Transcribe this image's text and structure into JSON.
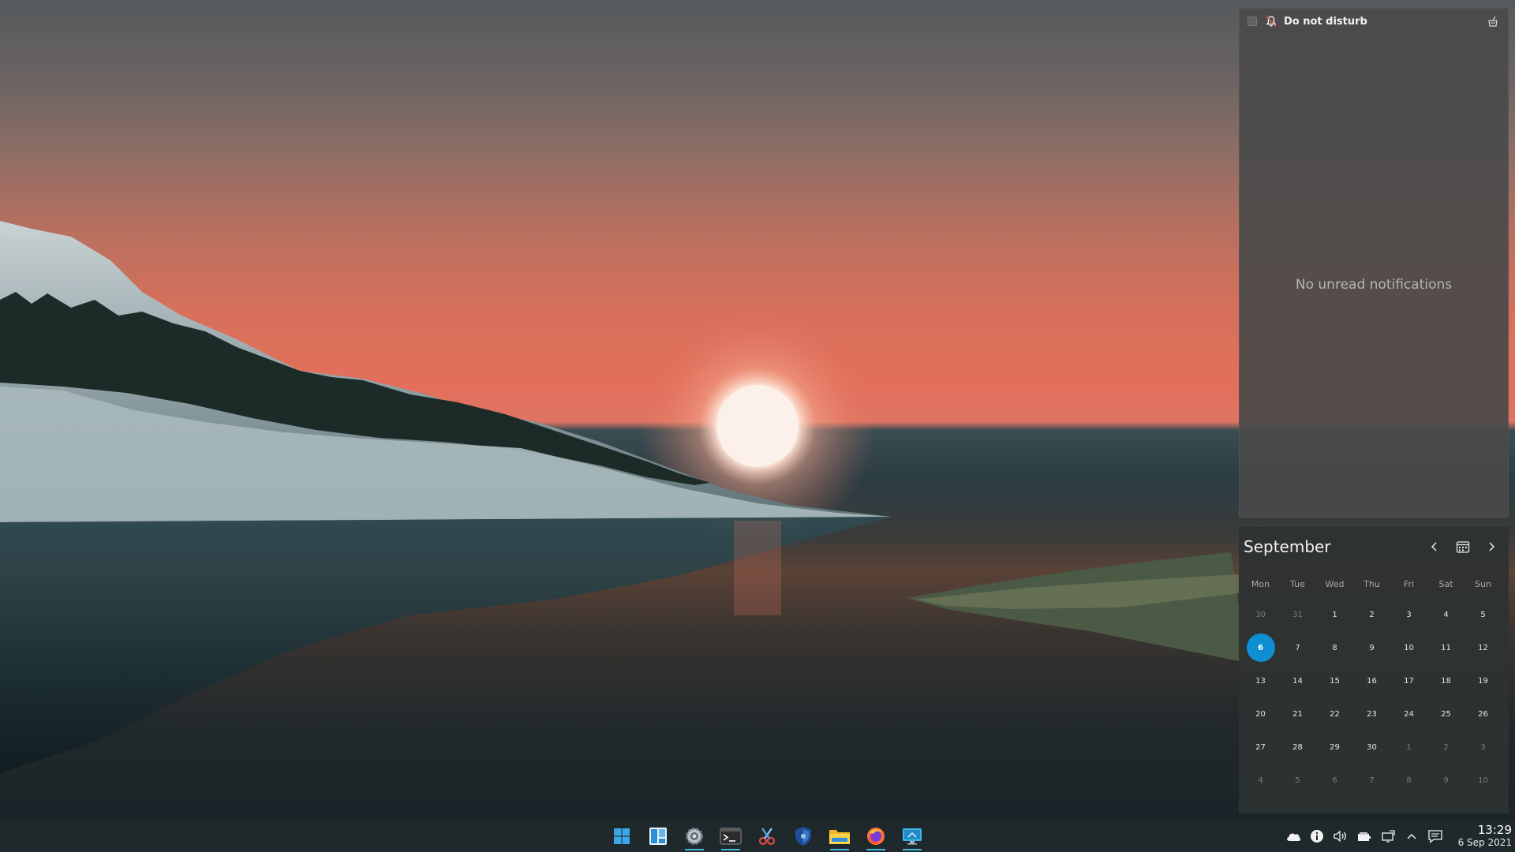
{
  "notifications": {
    "dnd_label": "Do not disturb",
    "empty_message": "No unread notifications"
  },
  "calendar": {
    "month": "September",
    "weekdays": [
      "Mon",
      "Tue",
      "Wed",
      "Thu",
      "Fri",
      "Sat",
      "Sun"
    ],
    "weeks": [
      [
        "30",
        "31",
        "1",
        "2",
        "3",
        "4",
        "5"
      ],
      [
        "6",
        "7",
        "8",
        "9",
        "10",
        "11",
        "12"
      ],
      [
        "13",
        "14",
        "15",
        "16",
        "17",
        "18",
        "19"
      ],
      [
        "20",
        "21",
        "22",
        "23",
        "24",
        "25",
        "26"
      ],
      [
        "27",
        "28",
        "29",
        "30",
        "1",
        "2",
        "3"
      ],
      [
        "4",
        "5",
        "6",
        "7",
        "8",
        "9",
        "10"
      ]
    ],
    "today": "6",
    "accent_color": "#0e8fd4"
  },
  "taskbar": {
    "apps": [
      {
        "name": "start-menu",
        "icon": "windows-logo-icon",
        "active": false
      },
      {
        "name": "widgets",
        "icon": "widgets-icon",
        "active": false
      },
      {
        "name": "settings",
        "icon": "gear-icon",
        "active": true
      },
      {
        "name": "terminal",
        "icon": "terminal-icon",
        "active": true
      },
      {
        "name": "snipping-tool",
        "icon": "scissors-icon",
        "active": false
      },
      {
        "name": "windows-security",
        "icon": "shield-icon",
        "active": false
      },
      {
        "name": "file-explorer",
        "icon": "folder-icon",
        "active": true
      },
      {
        "name": "firefox",
        "icon": "firefox-icon",
        "active": true
      },
      {
        "name": "remote-desktop",
        "icon": "monitor-icon",
        "active": true
      }
    ],
    "tray_icons": [
      "cloud-icon",
      "info-icon",
      "volume-icon",
      "battery-icon",
      "display-icon",
      "chevron-up-icon",
      "notification-icon"
    ],
    "time": "13:29",
    "date": "6 Sep 2021"
  }
}
